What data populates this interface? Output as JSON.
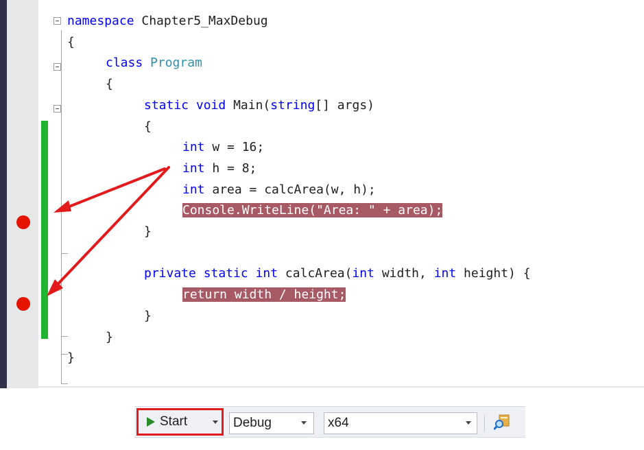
{
  "editor": {
    "lines": [
      {
        "tokens": [
          {
            "t": "namespace",
            "c": "kw"
          },
          {
            "t": " Chapter5_MaxDebug",
            "c": ""
          }
        ]
      },
      {
        "tokens": [
          {
            "t": "{",
            "c": ""
          }
        ]
      },
      {
        "tokens": [
          {
            "t": "class",
            "c": "kw"
          },
          {
            "t": " ",
            "c": ""
          },
          {
            "t": "Program",
            "c": "ty"
          }
        ]
      },
      {
        "tokens": [
          {
            "t": "{",
            "c": ""
          }
        ]
      },
      {
        "tokens": [
          {
            "t": "static",
            "c": "kw"
          },
          {
            "t": " ",
            "c": ""
          },
          {
            "t": "void",
            "c": "kw"
          },
          {
            "t": " Main(",
            "c": ""
          },
          {
            "t": "string",
            "c": "kw"
          },
          {
            "t": "[] args)",
            "c": ""
          }
        ]
      },
      {
        "tokens": [
          {
            "t": "{",
            "c": ""
          }
        ]
      },
      {
        "tokens": [
          {
            "t": "int",
            "c": "kw"
          },
          {
            "t": " w = 16;",
            "c": ""
          }
        ]
      },
      {
        "tokens": [
          {
            "t": "int",
            "c": "kw"
          },
          {
            "t": " h = 8;",
            "c": ""
          }
        ]
      },
      {
        "tokens": [
          {
            "t": "int",
            "c": "kw"
          },
          {
            "t": " area = calcArea(w, h);",
            "c": ""
          }
        ]
      },
      {
        "tokens": [
          {
            "t": "Console.WriteLine(\"Area: \" + area);",
            "c": "hl"
          }
        ]
      },
      {
        "tokens": [
          {
            "t": "}",
            "c": ""
          }
        ]
      },
      {
        "tokens": []
      },
      {
        "tokens": [
          {
            "t": "private",
            "c": "kw"
          },
          {
            "t": " ",
            "c": ""
          },
          {
            "t": "static",
            "c": "kw"
          },
          {
            "t": " ",
            "c": ""
          },
          {
            "t": "int",
            "c": "kw"
          },
          {
            "t": " calcArea(",
            "c": ""
          },
          {
            "t": "int",
            "c": "kw"
          },
          {
            "t": " width, ",
            "c": ""
          },
          {
            "t": "int",
            "c": "kw"
          },
          {
            "t": " height) {",
            "c": ""
          }
        ]
      },
      {
        "tokens": [
          {
            "t": "return width / height;",
            "c": "hl"
          }
        ]
      },
      {
        "tokens": [
          {
            "t": "}",
            "c": ""
          }
        ]
      },
      {
        "tokens": [
          {
            "t": "}",
            "c": ""
          }
        ]
      },
      {
        "tokens": [
          {
            "t": "}",
            "c": ""
          }
        ]
      }
    ],
    "breakpoint_lines": [
      10,
      14
    ],
    "colors": {
      "keyword": "#0000ff",
      "type": "#2b91af",
      "breakpoint": "#e51400",
      "breakpoint_highlight": "#a85a64",
      "change_bar": "#1fb530",
      "annotation_arrow": "#e31a1c"
    }
  },
  "toolbar": {
    "start_label": "Start",
    "start_icon": "play-icon",
    "configuration": "Debug",
    "platform": "x64",
    "find_icon": "find-in-files-icon"
  }
}
